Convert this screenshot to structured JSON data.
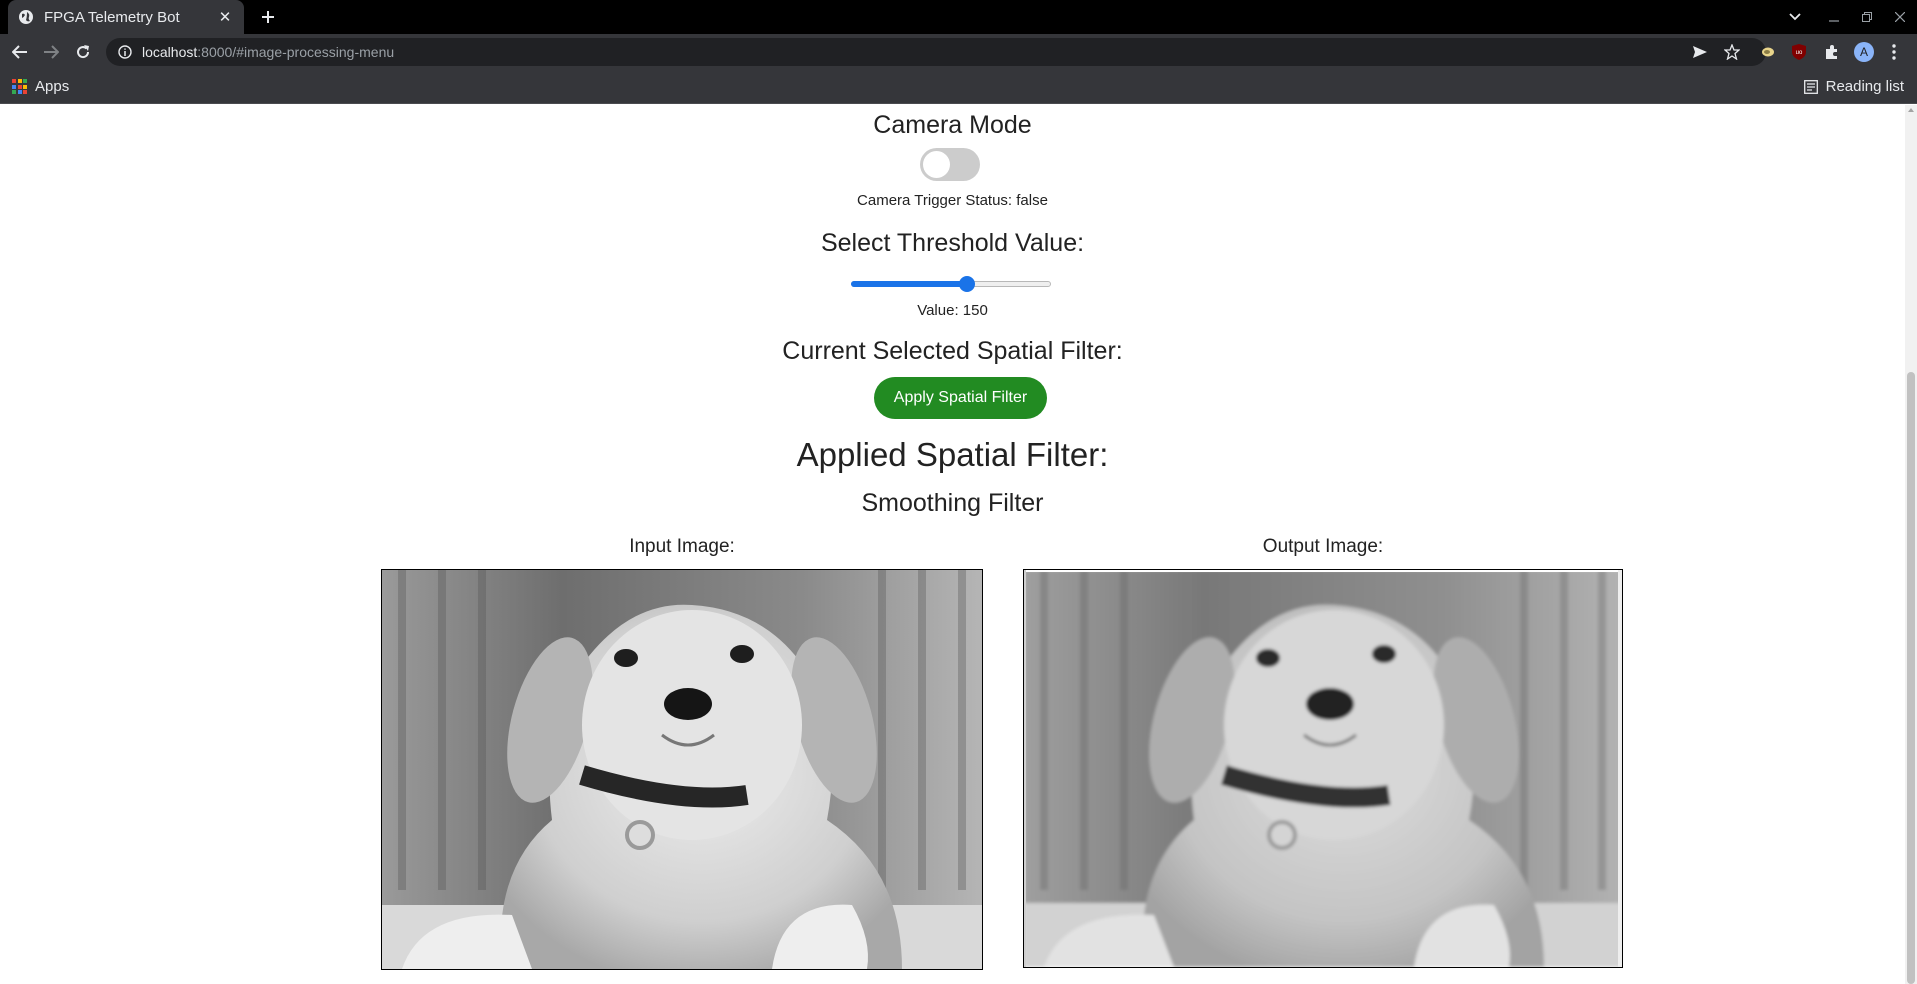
{
  "browser": {
    "tab_title": "FPGA Telemetry Bot",
    "tab_close": "✕",
    "new_tab": "+",
    "url_host": "localhost",
    "url_rest": ":8000/#image-processing-menu",
    "bookmarks_apps": "Apps",
    "reading_list": "Reading list",
    "profile_initial": "A"
  },
  "page": {
    "camera_heading": "Camera Mode",
    "camera_toggle_on": false,
    "camera_trigger_status": "Camera Trigger Status: false",
    "threshold_heading": "Select Threshold Value:",
    "threshold_value": 150,
    "threshold_max": 255,
    "threshold_value_text": "Value: 150",
    "current_filter_heading": "Current Selected Spatial Filter:",
    "apply_button_label": "Apply Spatial Filter",
    "applied_filter_heading": "Applied Spatial Filter:",
    "applied_filter_name": "Smoothing Filter",
    "input_image_label": "Input Image:",
    "output_image_label": "Output Image:"
  },
  "colors": {
    "apply_button": "#228b22",
    "slider_accent": "#1a73e8"
  }
}
